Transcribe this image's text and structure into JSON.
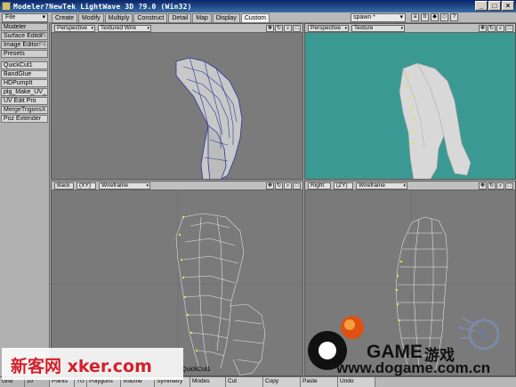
{
  "window": {
    "title": "Modeler?NewTek LightWave 3D ?9.0 (Win32)",
    "buttons": {
      "minimize": "_",
      "maximize": "□",
      "close": "×"
    }
  },
  "toolbar": {
    "file_menu": "File",
    "tabs": [
      "Create",
      "Modify",
      "Multiply",
      "Construct",
      "Detail",
      "Map",
      "Display",
      "Custom"
    ],
    "active_tab": "Custom",
    "spawn_select": "spawn *",
    "icons": [
      "a",
      "b",
      "◆",
      "◇",
      "?"
    ]
  },
  "left_panel": {
    "group": "Modeler",
    "items": [
      {
        "label": "Surface Editor",
        "hint": "F5"
      },
      {
        "label": "Image Editor",
        "hint": "F6"
      },
      {
        "label": "Presets",
        "hint": ""
      }
    ],
    "plugins": [
      "QuickCut1",
      "BandGlue",
      "HDPumpIt",
      "plg_Make_UV_",
      "UV Edit Pro",
      "MergeTrigonsX",
      "Poz Extender"
    ]
  },
  "viewports": [
    {
      "view": "Perspective",
      "mode": "Textured Wire",
      "bg": "#7b7b7b"
    },
    {
      "view": "Perspective",
      "mode": "Texture",
      "bg": "#3a9a93"
    },
    {
      "view": "Back",
      "axis": "(XY)",
      "mode": "Wireframe",
      "bg": "#7a7a7a"
    },
    {
      "view": "Right",
      "axis": "(ZY)",
      "mode": "Wireframe",
      "bg": "#7a7a7a"
    }
  ],
  "status": {
    "items": [
      "Grid",
      "10",
      "Points",
      "TG",
      "Polygons",
      "Volume",
      "Symmetry",
      "Modes",
      "Cut",
      "Copy",
      "Paste",
      "Undo"
    ],
    "tool": "QuickCut1"
  },
  "watermarks": {
    "left": "新客网 xker.com",
    "game": "GAME",
    "game_cn": "游戏",
    "url": "www.dogame.com.cn"
  },
  "colors": {
    "title_bar": "#0a246a",
    "texture_bg": "#3a9a93",
    "wireframe_blue": "#2a3a9a",
    "point_yellow": "#e8e050",
    "watermark_red": "#d3202a"
  }
}
